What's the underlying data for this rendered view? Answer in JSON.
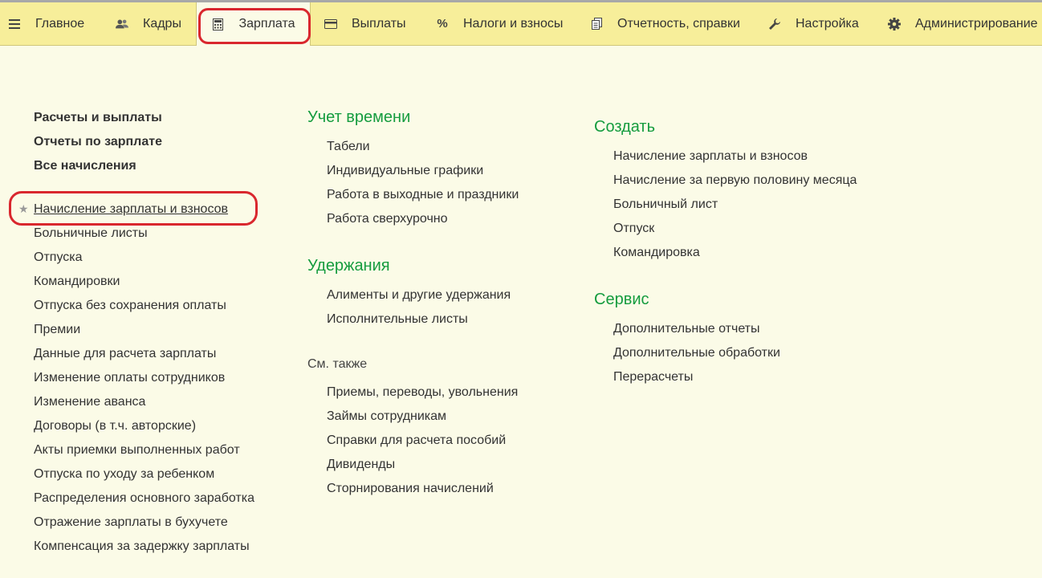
{
  "tabs": [
    {
      "label": "Главное",
      "icon": "hamburger-icon"
    },
    {
      "label": "Кадры",
      "icon": "people-icon"
    },
    {
      "label": "Зарплата",
      "icon": "calculator-icon",
      "active": true
    },
    {
      "label": "Выплаты",
      "icon": "wallet-icon"
    },
    {
      "label": "Налоги и взносы",
      "icon": "percent-icon"
    },
    {
      "label": "Отчетность, справки",
      "icon": "documents-icon"
    },
    {
      "label": "Настройка",
      "icon": "wrench-icon"
    },
    {
      "label": "Администрирование",
      "icon": "gear-icon"
    }
  ],
  "tab_symbols": {
    "percent": "%"
  },
  "col1": {
    "bold_items": [
      "Расчеты и выплаты",
      "Отчеты по зарплате",
      "Все начисления"
    ],
    "favorite_marker": "★",
    "items": [
      "Начисление зарплаты и взносов",
      "Больничные листы",
      "Отпуска",
      "Командировки",
      "Отпуска без сохранения оплаты",
      "Премии",
      "Данные для расчета зарплаты",
      "Изменение оплаты сотрудников",
      "Изменение аванса",
      "Договоры (в т.ч. авторские)",
      "Акты приемки выполненных работ",
      "Отпуска по уходу за ребенком",
      "Распределения основного заработка",
      "Отражение зарплаты в бухучете",
      "Компенсация за задержку зарплаты"
    ]
  },
  "col2": {
    "time": {
      "title": "Учет времени",
      "items": [
        "Табели",
        "Индивидуальные графики",
        "Работа в выходные и праздники",
        "Работа сверхурочно"
      ]
    },
    "deductions": {
      "title": "Удержания",
      "items": [
        "Алименты и другие удержания",
        "Исполнительные листы"
      ]
    },
    "see_also": {
      "title": "См. также",
      "items": [
        "Приемы, переводы, увольнения",
        "Займы сотрудникам",
        "Справки для расчета пособий",
        "Дивиденды",
        "Сторнирования начислений"
      ]
    }
  },
  "col3": {
    "create": {
      "title": "Создать",
      "items": [
        "Начисление зарплаты и взносов",
        "Начисление за первую половину месяца",
        "Больничный лист",
        "Отпуск",
        "Командировка"
      ]
    },
    "service": {
      "title": "Сервис",
      "items": [
        "Дополнительные отчеты",
        "Дополнительные обработки",
        "Перерасчеты"
      ]
    }
  },
  "colors": {
    "heading": "#159c3f",
    "highlight": "#d9272e",
    "topbar": "#f7ee9a",
    "background": "#fbfbe7"
  }
}
